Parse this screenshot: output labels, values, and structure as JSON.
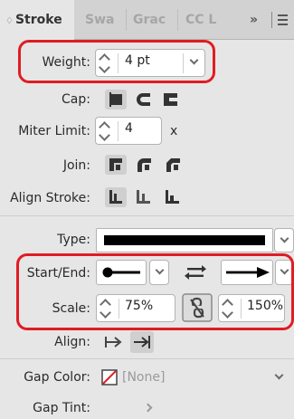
{
  "tabs": [
    {
      "label": "Stroke",
      "arrows": "♢"
    },
    {
      "label": "Swa"
    },
    {
      "label": "Grac"
    },
    {
      "label": "CC L"
    }
  ],
  "tabbar": {
    "more": "»"
  },
  "weight": {
    "label": "Weight:",
    "value": "4 pt"
  },
  "cap": {
    "label": "Cap:"
  },
  "miter": {
    "label": "Miter Limit:",
    "value": "4",
    "suffix": "x"
  },
  "join": {
    "label": "Join:"
  },
  "align_stroke": {
    "label": "Align Stroke:"
  },
  "type": {
    "label": "Type:"
  },
  "start_end": {
    "label": "Start/End:"
  },
  "scale": {
    "label": "Scale:",
    "start_value": "75%",
    "end_value": "150%"
  },
  "align": {
    "label": "Align:"
  },
  "gap_color": {
    "label": "Gap Color:",
    "value": "[None]"
  },
  "gap_tint": {
    "label": "Gap Tint:"
  },
  "colors": {
    "highlight": "#e01c24",
    "panel_bg": "#e6e6e6",
    "tab_bg": "#d2d2d2",
    "disabled_text": "#9a9a9a"
  }
}
